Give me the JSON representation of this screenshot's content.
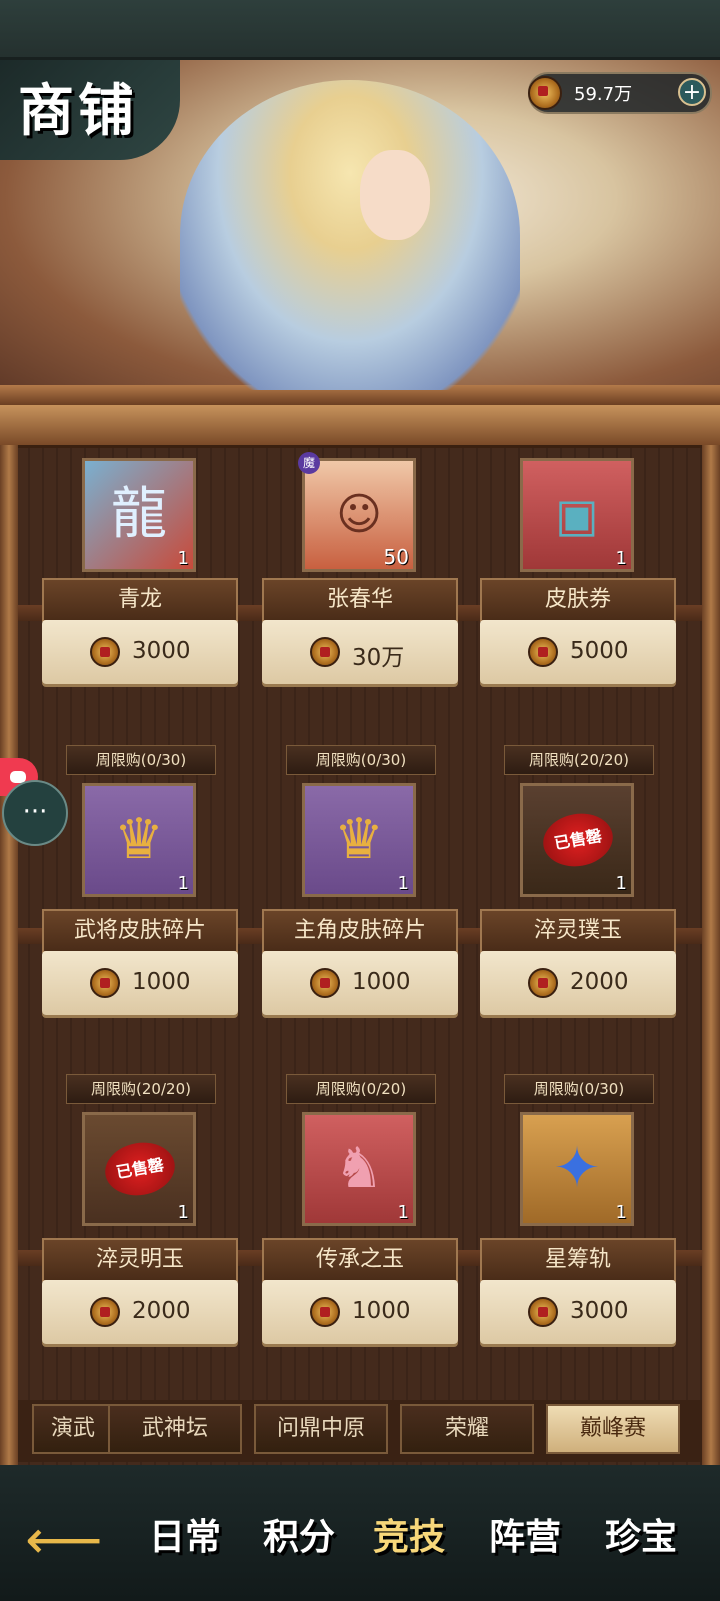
{
  "header": {
    "title": "商铺",
    "currency_value": "59.7万",
    "plus_label": "+"
  },
  "items": [
    {
      "name": "青龙",
      "price": "3000",
      "count": "1",
      "limit": "",
      "soldout": false,
      "icon": "dragon-icon"
    },
    {
      "name": "张春华",
      "price": "30万",
      "count": "50",
      "limit": "",
      "soldout": false,
      "icon": "hero-portrait-icon",
      "badge": "魔"
    },
    {
      "name": "皮肤券",
      "price": "5000",
      "count": "1",
      "limit": "",
      "soldout": false,
      "icon": "skin-ticket-icon"
    },
    {
      "name": "武将皮肤碎片",
      "price": "1000",
      "count": "1",
      "limit": "周限购(0/30)",
      "soldout": false,
      "icon": "helmet-icon"
    },
    {
      "name": "主角皮肤碎片",
      "price": "1000",
      "count": "1",
      "limit": "周限购(0/30)",
      "soldout": false,
      "icon": "helmet-icon"
    },
    {
      "name": "淬灵璞玉",
      "price": "2000",
      "count": "1",
      "limit": "周限购(20/20)",
      "soldout": true,
      "icon": "jade-icon"
    },
    {
      "name": "淬灵明玉",
      "price": "2000",
      "count": "1",
      "limit": "周限购(20/20)",
      "soldout": true,
      "icon": "jade-icon"
    },
    {
      "name": "传承之玉",
      "price": "1000",
      "count": "1",
      "limit": "周限购(0/20)",
      "soldout": false,
      "icon": "red-jade-icon"
    },
    {
      "name": "星筹轨",
      "price": "3000",
      "count": "1",
      "limit": "周限购(0/30)",
      "soldout": false,
      "icon": "star-orbit-icon"
    }
  ],
  "soldout_label": "已售罄",
  "tabs": [
    "演武",
    "武神坛",
    "问鼎中原",
    "荣耀",
    "巅峰赛"
  ],
  "bottom_nav": [
    {
      "label": "日常"
    },
    {
      "label": "积分"
    },
    {
      "label": "竞技"
    },
    {
      "label": "阵营"
    },
    {
      "label": "珍宝"
    }
  ],
  "colors": {
    "accent": "#f7d77a",
    "soldout": "#e02020",
    "wood": "#6a4428"
  }
}
